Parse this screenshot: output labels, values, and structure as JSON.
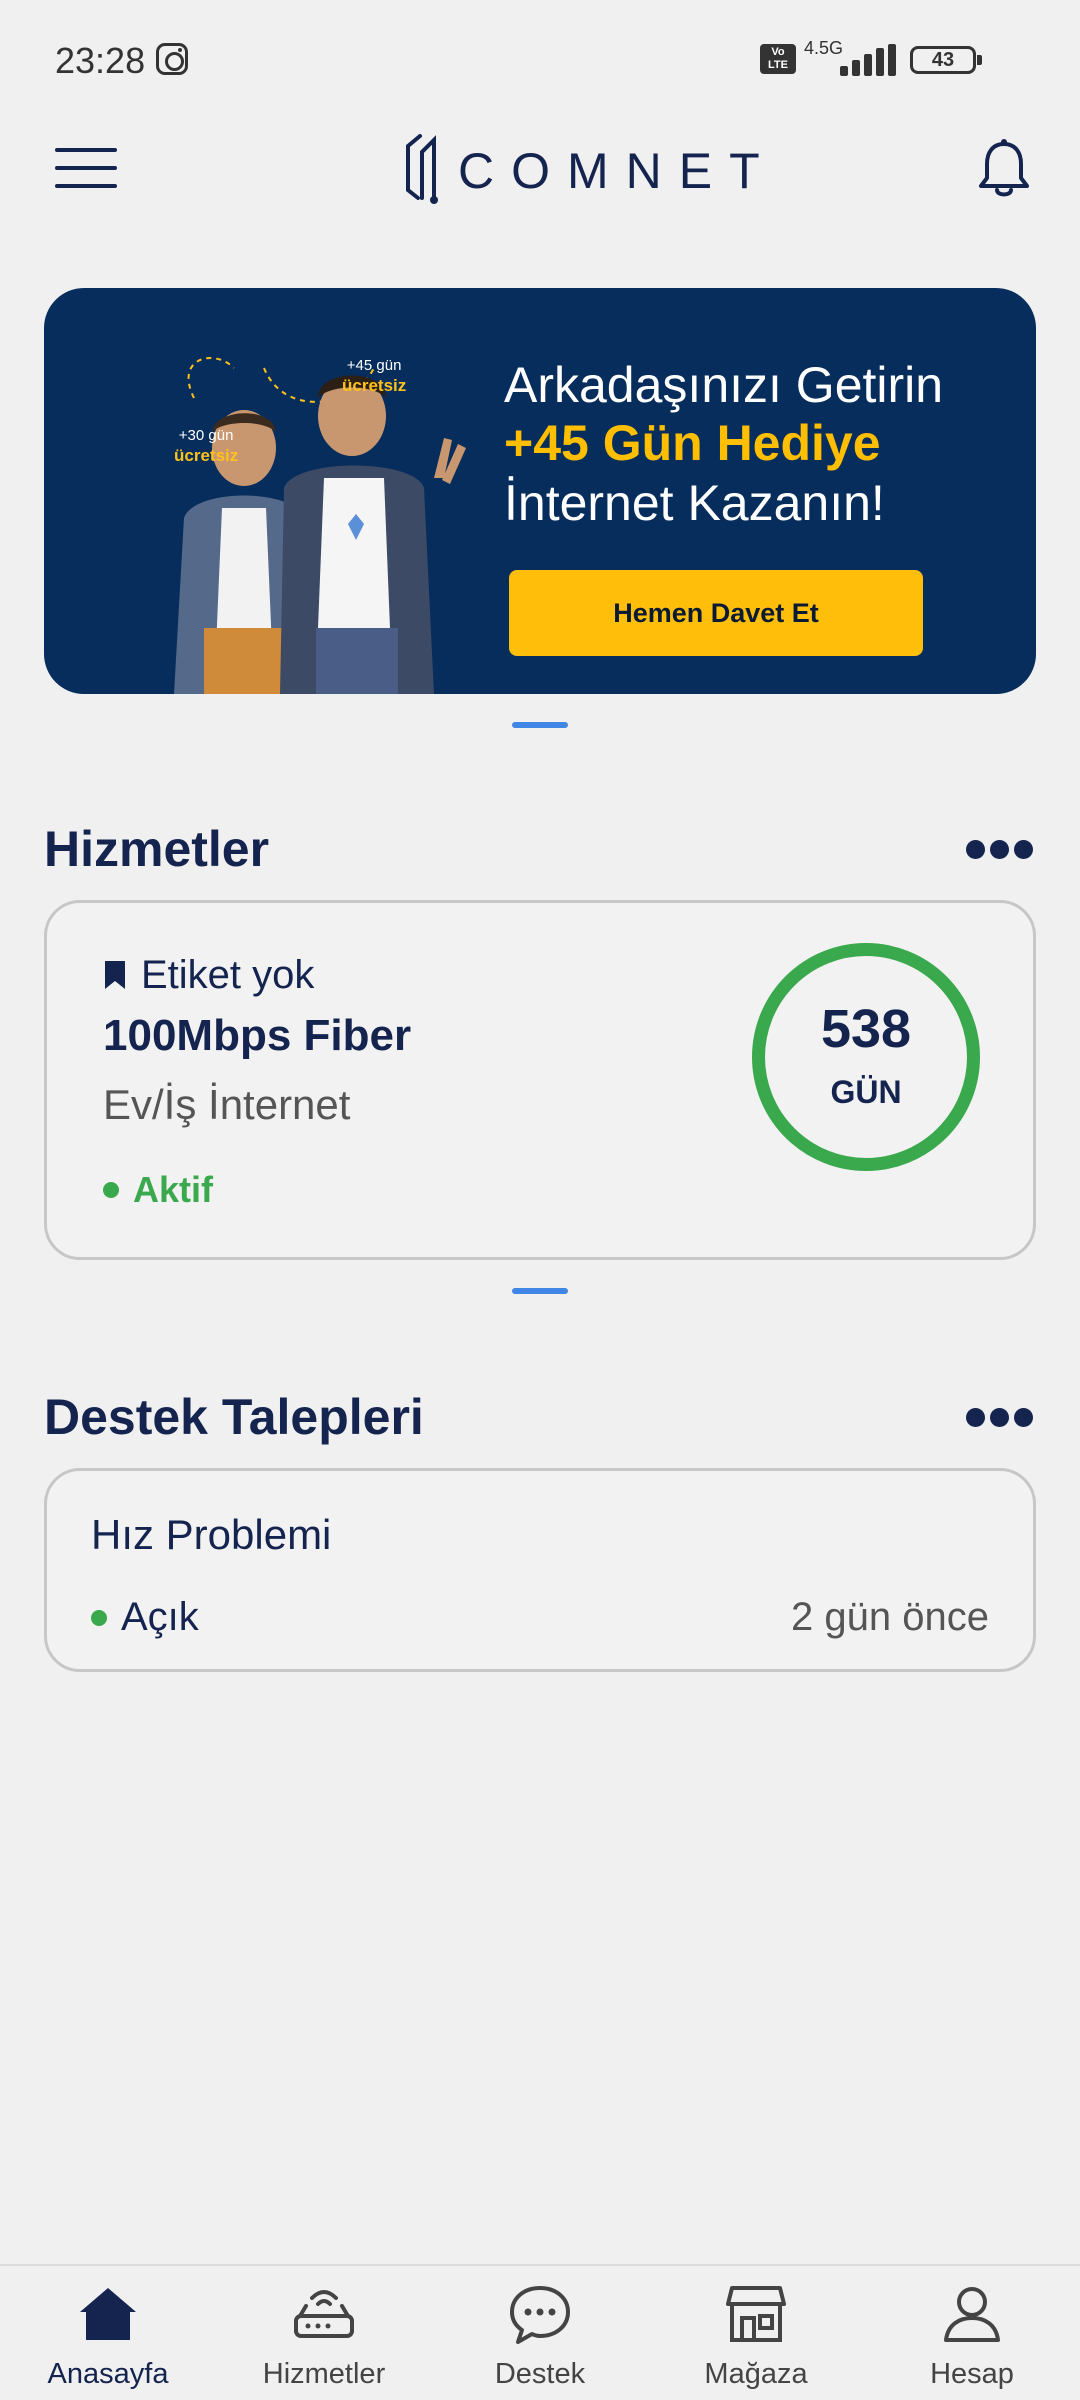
{
  "status_bar": {
    "time": "23:28",
    "network": "4.5G",
    "volte": "Vo LTE",
    "battery": "43"
  },
  "header": {
    "logo_text": "COMNET",
    "menu_icon": "hamburger-menu-icon",
    "notification_icon": "bell-icon"
  },
  "banner": {
    "line1": "Arkadaşınızı Getirin",
    "line2": "+45 Gün Hediye",
    "line3": "İnternet Kazanın!",
    "cta": "Hemen Davet Et",
    "badge_30_top": "+30 gün",
    "badge_30_bottom": "ücretsiz",
    "badge_45_top": "+45 gün",
    "badge_45_bottom": "ücretsiz",
    "accent_color": "#ffbe0a",
    "background_color": "#062d5c"
  },
  "services": {
    "title": "Hizmetler",
    "card": {
      "tag": "Etiket yok",
      "name": "100Mbps Fiber",
      "type": "Ev/İş İnternet",
      "status": "Aktif",
      "days": "538",
      "days_unit": "GÜN",
      "status_color": "#3aa84c"
    }
  },
  "support": {
    "title": "Destek Talepleri",
    "ticket": {
      "title": "Hız Problemi",
      "status": "Açık",
      "time": "2 gün önce"
    }
  },
  "bottom_nav": {
    "items": [
      {
        "label": "Anasayfa",
        "icon": "home-icon",
        "active": true
      },
      {
        "label": "Hizmetler",
        "icon": "router-icon",
        "active": false
      },
      {
        "label": "Destek",
        "icon": "chat-icon",
        "active": false
      },
      {
        "label": "Mağaza",
        "icon": "store-icon",
        "active": false
      },
      {
        "label": "Hesap",
        "icon": "user-icon",
        "active": false
      }
    ]
  }
}
